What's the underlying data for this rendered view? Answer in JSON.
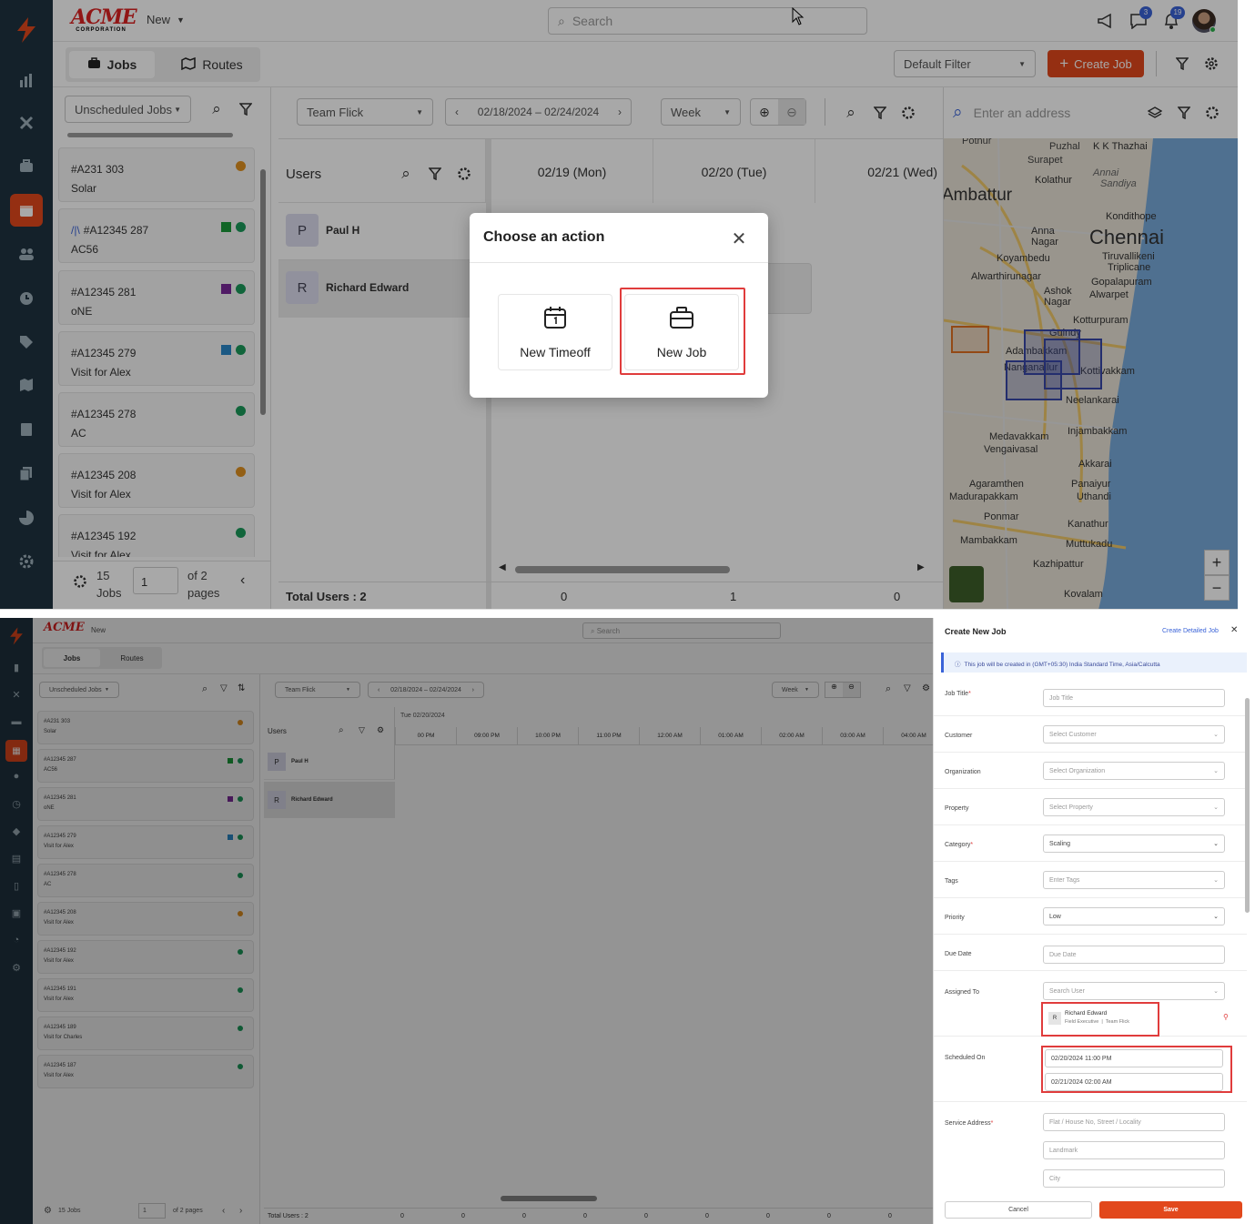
{
  "brand": {
    "logo": "ACME",
    "logo_sub": "CORPORATION",
    "new_label": "New"
  },
  "header": {
    "search_placeholder": "Search",
    "chat_count": "3",
    "notif_count": "19"
  },
  "tabs": {
    "jobs": "Jobs",
    "routes": "Routes"
  },
  "toolbar": {
    "default_filter": "Default Filter",
    "create_job": "Create Job"
  },
  "left_panel": {
    "filter": "Unscheduled Jobs",
    "jobs": [
      {
        "id": "#A231 303",
        "desc": "Solar",
        "marks": [
          "orange"
        ]
      },
      {
        "id": "#A12345 287",
        "desc": "AC56",
        "marks": [
          "green-sq",
          "green"
        ],
        "prefix": "/|\\"
      },
      {
        "id": "#A12345 281",
        "desc": "oNE",
        "marks": [
          "purple-sq",
          "green"
        ]
      },
      {
        "id": "#A12345 279",
        "desc": "Visit for Alex",
        "marks": [
          "blue-sq",
          "green"
        ]
      },
      {
        "id": "#A12345 278",
        "desc": "AC",
        "marks": [
          "green"
        ]
      },
      {
        "id": "#A12345 208",
        "desc": "Visit for Alex",
        "marks": [
          "orange"
        ]
      },
      {
        "id": "#A12345 192",
        "desc": "Visit for Alex",
        "marks": [
          "green"
        ]
      }
    ],
    "footer": {
      "count": "15",
      "count_label": "Jobs",
      "page": "1",
      "of": "of 2",
      "pages": "pages"
    }
  },
  "scheduler": {
    "team": "Team Flick",
    "range": "02/18/2024 – 02/24/2024",
    "view": "Week",
    "users_label": "Users",
    "days": [
      "02/19 (Mon)",
      "02/20 (Tue)",
      "02/21 (Wed)"
    ],
    "users": [
      {
        "initial": "P",
        "name": "Paul H"
      },
      {
        "initial": "R",
        "name": "Richard Edward"
      }
    ],
    "total_users": "Total Users : 2",
    "totals": [
      "0",
      "1",
      "0"
    ]
  },
  "map": {
    "placeholder": "Enter an address",
    "places": [
      "Pothur",
      "Puzhal",
      "K K Thazhai",
      "Surapet",
      "Annai",
      "Kolathur",
      "Sandiya",
      "Ambattur",
      "Kondithope",
      "Chennai",
      "Anna",
      "Nagar",
      "Koyambedu",
      "Tiruvallikeni",
      "Triplicane",
      "Alwarthirunagar",
      "Gopalapuram",
      "Ashok",
      "Alwarpet",
      "Nagar",
      "Kotturpuram",
      "Guindy",
      "Adambakkam",
      "Nanganallur",
      "Kottivakkam",
      "Neelankarai",
      "Medavakkam",
      "Injambakkam",
      "Vengaivasal",
      "Akkarai",
      "Agaramthen",
      "Panaiyur",
      "Madurapakkam",
      "Uthandi",
      "Ponmar",
      "Kanathur",
      "Mambakkam",
      "Muttukadu",
      "Kazhipattur",
      "Kovalam"
    ],
    "zoom_in": "+",
    "zoom_out": "−"
  },
  "dialog": {
    "title": "Choose an action",
    "timeoff": "New Timeoff",
    "job": "New Job"
  },
  "bottom": {
    "tabs": {
      "jobs": "Jobs",
      "routes": "Routes"
    },
    "filter": "Unscheduled Jobs",
    "team": "Team Flick",
    "range": "02/18/2024 – 02/24/2024",
    "view": "Week",
    "date_heading": "Tue 02/20/2024",
    "times": [
      "00 PM",
      "09:00 PM",
      "10:00 PM",
      "11:00 PM",
      "12:00 AM",
      "01:00 AM",
      "02:00 AM",
      "03:00 AM",
      "04:00 AM"
    ],
    "users": [
      {
        "initial": "P",
        "name": "Paul H"
      },
      {
        "initial": "R",
        "name": "Richard Edward"
      }
    ],
    "jobs": [
      {
        "id": "#A231 303",
        "desc": "Solar"
      },
      {
        "id": "#A12345 287",
        "desc": "AC56"
      },
      {
        "id": "#A12345 281",
        "desc": "oNE"
      },
      {
        "id": "#A12345 279",
        "desc": "Visit for Alex"
      },
      {
        "id": "#A12345 278",
        "desc": "AC"
      },
      {
        "id": "#A12345 208",
        "desc": "Visit for Alex"
      },
      {
        "id": "#A12345 192",
        "desc": "Visit for Alex"
      },
      {
        "id": "#A12345 191",
        "desc": "Visit for Alex"
      },
      {
        "id": "#A12345 189",
        "desc": "Visit for Charles"
      },
      {
        "id": "#A12345 187",
        "desc": "Visit for Alex"
      }
    ],
    "footer": {
      "jobs": "15 Jobs",
      "page": "1",
      "of": "of 2 pages",
      "total": "Total Users : 2"
    },
    "totals": [
      "0",
      "0",
      "0",
      "0",
      "0",
      "0",
      "0",
      "0",
      "0"
    ]
  },
  "form": {
    "title": "Create New Job",
    "detailed": "Create Detailed Job",
    "info": "This job will be created in (GMT+05:30) India Standard Time, Asia/Calcutta",
    "job_title": "Job Title",
    "job_title_ph": "Job Title",
    "customer": "Customer",
    "customer_ph": "Select Customer",
    "organization": "Organization",
    "organization_ph": "Select Organization",
    "property": "Property",
    "property_ph": "Select Property",
    "category": "Category",
    "category_val": "Scaling",
    "tags": "Tags",
    "tags_ph": "Enter Tags",
    "priority": "Priority",
    "priority_val": "Low",
    "due_date": "Due Date",
    "due_date_ph": "Due Date",
    "assigned": "Assigned To",
    "assigned_ph": "Search User",
    "assignee_initial": "R",
    "assignee_name": "Richard Edward",
    "assignee_role": "Field Executive  |  Team Flick",
    "scheduled": "Scheduled On",
    "start": "02/20/2024 11:00 PM",
    "end": "02/21/2024 02:00 AM",
    "address": "Service Address",
    "addr1": "Flat / House No, Street / Locality",
    "addr2": "Landmark",
    "addr3": "City",
    "cancel": "Cancel",
    "save": "Save"
  },
  "colors": {
    "accent": "#e2481c",
    "sidebar": "#1f3340",
    "highlight": "#e03c3c"
  }
}
